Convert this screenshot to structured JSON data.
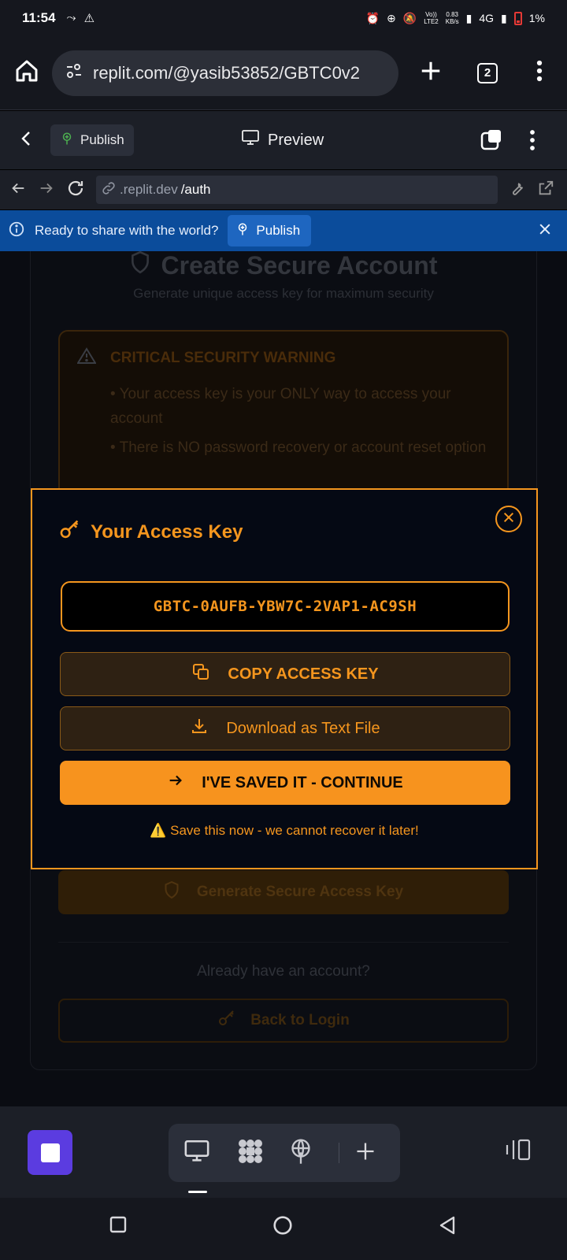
{
  "status_bar": {
    "time": "11:54",
    "network_speed": "0.83",
    "network_speed_unit": "KB/s",
    "network": "4G",
    "battery": "1%"
  },
  "browser": {
    "url": "replit.com/@yasib53852/GBTC0v2",
    "tab_count": "2",
    "icons": [
      "home-icon",
      "site-settings-icon",
      "new-tab-icon",
      "tab-switcher-icon",
      "more-icon"
    ]
  },
  "replit_toolbar": {
    "publish_label": "Publish",
    "preview_label": "Preview"
  },
  "webview": {
    "url_domain": ".replit.dev",
    "url_path": "/auth"
  },
  "banner": {
    "message": "Ready to share with the world?",
    "publish_label": "Publish"
  },
  "page": {
    "title": "Create Secure Account",
    "subtitle": "Generate unique access key for maximum security",
    "warning_title": "CRITICAL SECURITY WARNING",
    "warning_items": [
      "• Your access key is your ONLY way to access your account",
      "• There is NO password recovery or account reset option"
    ],
    "generate_label": "Generate Secure Access Key",
    "already_text": "Already have an account?",
    "back_label": "Back to Login"
  },
  "modal": {
    "title": "Your Access Key",
    "access_key": "GBTC-0AUFB-YBW7C-2VAP1-AC9SH",
    "copy_label": "COPY ACCESS KEY",
    "download_label": "Download as Text File",
    "continue_label": "I'VE SAVED IT - CONTINUE",
    "note": "⚠️ Save this now - we cannot recover it later!"
  },
  "colors": {
    "accent": "#f5961e",
    "banner": "#0b4c9b",
    "app_button": "#5b3ce0"
  }
}
